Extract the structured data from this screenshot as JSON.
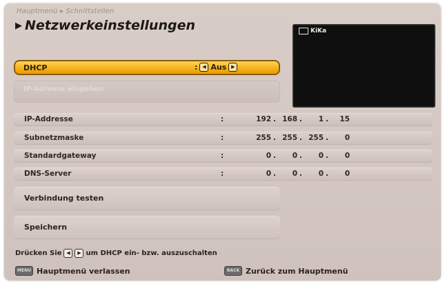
{
  "header": {
    "breadcrumb": "Hauptmenü ▸ Schnittstellen",
    "title": "Netzwerkeinstellungen"
  },
  "preview": {
    "channel": "KiKa"
  },
  "dhcp": {
    "label": "DHCP",
    "separator": ":",
    "value": "Aus"
  },
  "disabled_item": {
    "label": "IP-Adresse eingeben"
  },
  "network": {
    "rows": [
      {
        "label": "IP-Addresse",
        "octets": [
          "192",
          "168",
          "1",
          "15"
        ]
      },
      {
        "label": "Subnetzmaske",
        "octets": [
          "255",
          "255",
          "255",
          "0"
        ]
      },
      {
        "label": "Standardgateway",
        "octets": [
          "0",
          "0",
          "0",
          "0"
        ]
      },
      {
        "label": "DNS-Server",
        "octets": [
          "0",
          "0",
          "0",
          "0"
        ]
      }
    ],
    "colon": ":",
    "dot": "."
  },
  "actions": {
    "test": "Verbindung testen",
    "save": "Speichern"
  },
  "hint": {
    "prefix": "Drücken Sie",
    "suffix": "um DHCP ein- bzw. auszuschalten"
  },
  "footer": {
    "menu_key": "MENU",
    "menu_label": "Hauptmenü verlassen",
    "back_key": "BACK",
    "back_label": "Zurück zum Hauptmenü"
  },
  "icons": {
    "left": "arrow-left-icon",
    "right": "arrow-right-icon",
    "tv": "tv-icon"
  },
  "colors": {
    "highlight": "#f6b21b",
    "panel": "#d4c7c1",
    "preview_bg": "#0f0f0f"
  }
}
